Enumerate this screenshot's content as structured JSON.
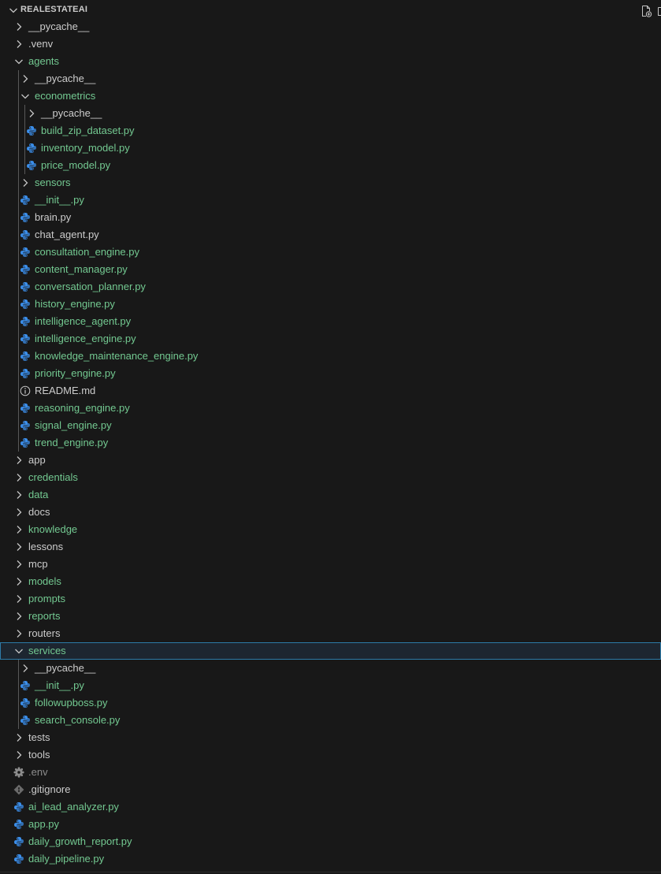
{
  "explorer": {
    "title": "REALESTATEAI",
    "actions": {
      "new_file_icon": "new-file-icon",
      "new_folder_icon": "new-folder-icon"
    }
  },
  "colors": {
    "background": "#181818",
    "modified_green": "#73c991",
    "default_text": "#cccccc",
    "ignored_grey": "#8c8c8c",
    "python_icon": "#3b8eea",
    "selection_border": "#2d7ba8"
  },
  "tree": [
    {
      "label": "__pycache__",
      "kind": "folder",
      "expanded": false,
      "depth": 1,
      "color": "white"
    },
    {
      "label": ".venv",
      "kind": "folder",
      "expanded": false,
      "depth": 1,
      "color": "white"
    },
    {
      "label": "agents",
      "kind": "folder",
      "expanded": true,
      "depth": 1,
      "color": "green"
    },
    {
      "label": "__pycache__",
      "kind": "folder",
      "expanded": false,
      "depth": 2,
      "color": "white"
    },
    {
      "label": "econometrics",
      "kind": "folder",
      "expanded": true,
      "depth": 2,
      "color": "green"
    },
    {
      "label": "__pycache__",
      "kind": "folder",
      "expanded": false,
      "depth": 3,
      "color": "white"
    },
    {
      "label": "build_zip_dataset.py",
      "kind": "python",
      "depth": 3,
      "color": "green"
    },
    {
      "label": "inventory_model.py",
      "kind": "python",
      "depth": 3,
      "color": "green"
    },
    {
      "label": "price_model.py",
      "kind": "python",
      "depth": 3,
      "color": "green"
    },
    {
      "label": "sensors",
      "kind": "folder",
      "expanded": false,
      "depth": 2,
      "color": "green"
    },
    {
      "label": "__init__.py",
      "kind": "python",
      "depth": 2,
      "color": "green"
    },
    {
      "label": "brain.py",
      "kind": "python",
      "depth": 2,
      "color": "white"
    },
    {
      "label": "chat_agent.py",
      "kind": "python",
      "depth": 2,
      "color": "white"
    },
    {
      "label": "consultation_engine.py",
      "kind": "python",
      "depth": 2,
      "color": "green"
    },
    {
      "label": "content_manager.py",
      "kind": "python",
      "depth": 2,
      "color": "green"
    },
    {
      "label": "conversation_planner.py",
      "kind": "python",
      "depth": 2,
      "color": "green"
    },
    {
      "label": "history_engine.py",
      "kind": "python",
      "depth": 2,
      "color": "green"
    },
    {
      "label": "intelligence_agent.py",
      "kind": "python",
      "depth": 2,
      "color": "green"
    },
    {
      "label": "intelligence_engine.py",
      "kind": "python",
      "depth": 2,
      "color": "green"
    },
    {
      "label": "knowledge_maintenance_engine.py",
      "kind": "python",
      "depth": 2,
      "color": "green"
    },
    {
      "label": "priority_engine.py",
      "kind": "python",
      "depth": 2,
      "color": "green"
    },
    {
      "label": "README.md",
      "kind": "info",
      "depth": 2,
      "color": "white"
    },
    {
      "label": "reasoning_engine.py",
      "kind": "python",
      "depth": 2,
      "color": "green"
    },
    {
      "label": "signal_engine.py",
      "kind": "python",
      "depth": 2,
      "color": "green"
    },
    {
      "label": "trend_engine.py",
      "kind": "python",
      "depth": 2,
      "color": "green"
    },
    {
      "label": "app",
      "kind": "folder",
      "expanded": false,
      "depth": 1,
      "color": "white"
    },
    {
      "label": "credentials",
      "kind": "folder",
      "expanded": false,
      "depth": 1,
      "color": "green"
    },
    {
      "label": "data",
      "kind": "folder",
      "expanded": false,
      "depth": 1,
      "color": "green"
    },
    {
      "label": "docs",
      "kind": "folder",
      "expanded": false,
      "depth": 1,
      "color": "white"
    },
    {
      "label": "knowledge",
      "kind": "folder",
      "expanded": false,
      "depth": 1,
      "color": "green"
    },
    {
      "label": "lessons",
      "kind": "folder",
      "expanded": false,
      "depth": 1,
      "color": "white"
    },
    {
      "label": "mcp",
      "kind": "folder",
      "expanded": false,
      "depth": 1,
      "color": "white"
    },
    {
      "label": "models",
      "kind": "folder",
      "expanded": false,
      "depth": 1,
      "color": "green"
    },
    {
      "label": "prompts",
      "kind": "folder",
      "expanded": false,
      "depth": 1,
      "color": "green"
    },
    {
      "label": "reports",
      "kind": "folder",
      "expanded": false,
      "depth": 1,
      "color": "green"
    },
    {
      "label": "routers",
      "kind": "folder",
      "expanded": false,
      "depth": 1,
      "color": "white"
    },
    {
      "label": "services",
      "kind": "folder",
      "expanded": true,
      "depth": 1,
      "color": "green",
      "selected": true
    },
    {
      "label": "__pycache__",
      "kind": "folder",
      "expanded": false,
      "depth": 2,
      "color": "white"
    },
    {
      "label": "__init__.py",
      "kind": "python",
      "depth": 2,
      "color": "green"
    },
    {
      "label": "followupboss.py",
      "kind": "python",
      "depth": 2,
      "color": "green"
    },
    {
      "label": "search_console.py",
      "kind": "python",
      "depth": 2,
      "color": "green"
    },
    {
      "label": "tests",
      "kind": "folder",
      "expanded": false,
      "depth": 1,
      "color": "white"
    },
    {
      "label": "tools",
      "kind": "folder",
      "expanded": false,
      "depth": 1,
      "color": "white"
    },
    {
      "label": ".env",
      "kind": "gear",
      "depth": 1,
      "color": "grey"
    },
    {
      "label": ".gitignore",
      "kind": "git",
      "depth": 1,
      "color": "white"
    },
    {
      "label": "ai_lead_analyzer.py",
      "kind": "python",
      "depth": 1,
      "color": "green"
    },
    {
      "label": "app.py",
      "kind": "python",
      "depth": 1,
      "color": "green"
    },
    {
      "label": "daily_growth_report.py",
      "kind": "python",
      "depth": 1,
      "color": "green"
    },
    {
      "label": "daily_pipeline.py",
      "kind": "python",
      "depth": 1,
      "color": "green"
    }
  ]
}
